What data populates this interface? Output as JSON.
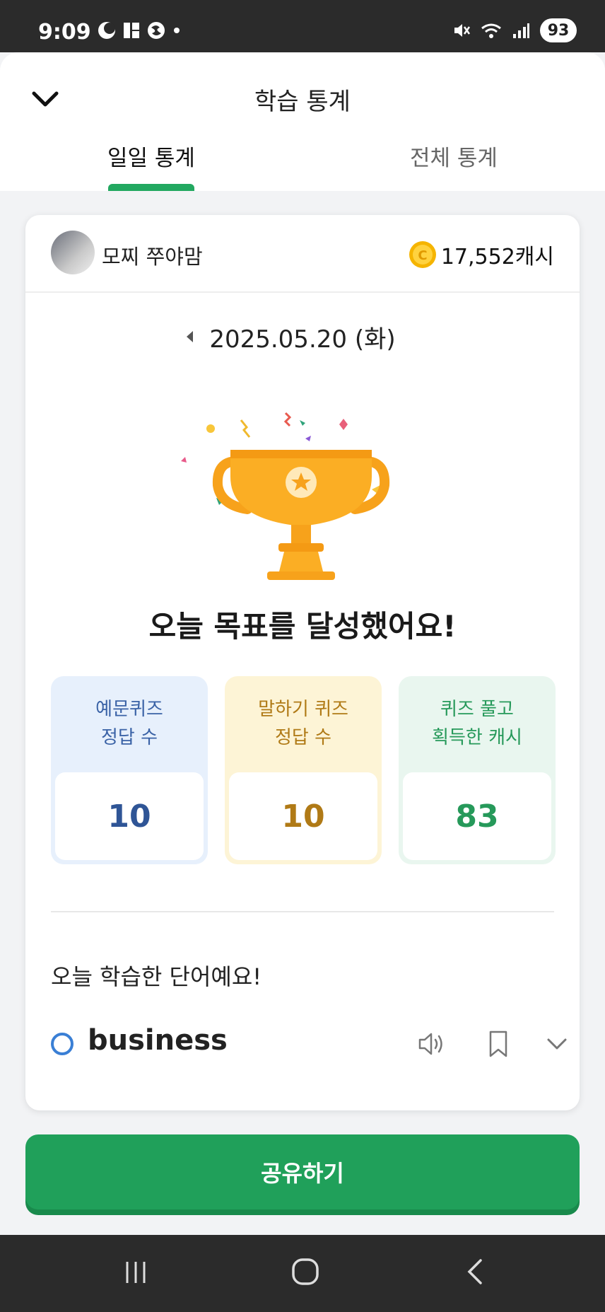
{
  "status_bar": {
    "time": "9:09",
    "battery": "93"
  },
  "header": {
    "title": "학습 통계",
    "tabs": [
      {
        "label": "일일 통계",
        "active": true
      },
      {
        "label": "전체 통계",
        "active": false
      }
    ]
  },
  "profile": {
    "name": "모찌 쭈야맘",
    "cash": "17,552캐시"
  },
  "date": {
    "label": "2025.05.20 (화)"
  },
  "goal": {
    "message": "오늘 목표를 달성했어요!"
  },
  "stats": [
    {
      "label": "예문퀴즈\n정답 수",
      "value": "10"
    },
    {
      "label": "말하기 퀴즈\n정답 수",
      "value": "10"
    },
    {
      "label": "퀴즈 풀고\n획득한 캐시",
      "value": "83"
    }
  ],
  "words": {
    "title": "오늘 학습한 단어예요!",
    "items": [
      {
        "word": "business"
      }
    ]
  },
  "share_button": {
    "label": "공유하기"
  },
  "colors": {
    "accent_green": "#20a05a",
    "stat_blue": "#2f5596",
    "stat_yellow": "#b07a16",
    "stat_green": "#26995a"
  },
  "icons": [
    "chevron-down-icon",
    "coin-icon",
    "caret-left-icon",
    "trophy-icon",
    "speaker-icon",
    "bookmark-icon",
    "expand-chevron-icon"
  ]
}
